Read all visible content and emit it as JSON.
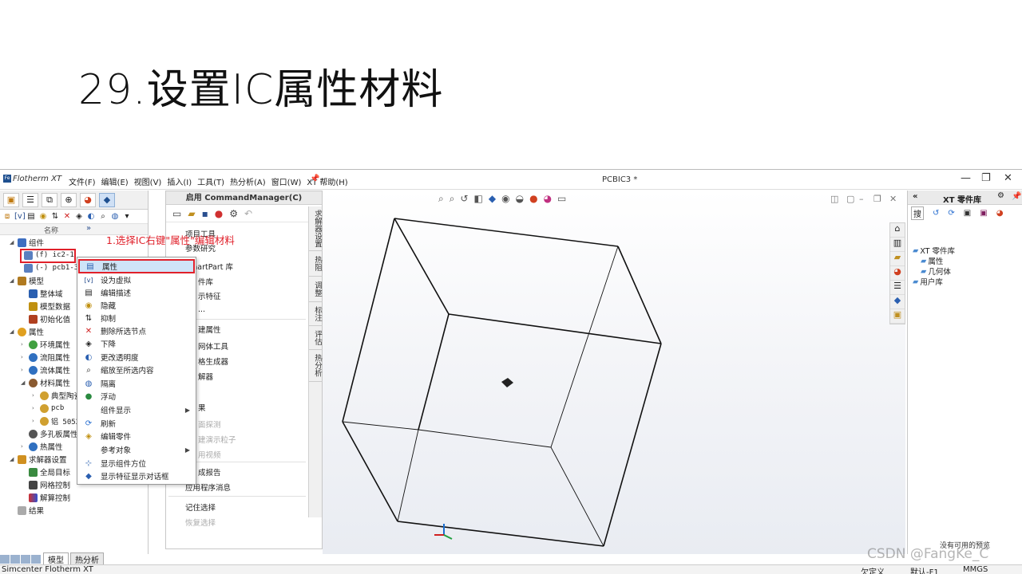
{
  "slide": {
    "title": "29.设置IC属性材料"
  },
  "titlebar": {
    "app_name": "Flotherm XT",
    "menu": [
      "文件(F)",
      "编辑(E)",
      "视图(V)",
      "插入(I)",
      "工具(T)",
      "热分析(A)",
      "窗口(W)",
      "XT 帮助(H)"
    ],
    "doc_title": "PCBIC3 *"
  },
  "left_panel": {
    "column_name": "名称",
    "annotation": "1.选择IC右键\"属性\"编辑材料",
    "tree": {
      "components": "组件",
      "ic": "(f) ic2-1",
      "pcb": "(-) pcb1-3",
      "model": "模型",
      "overall_domain": "整体域",
      "model_data": "模型数据",
      "initialization": "初始化值",
      "attributes": "属性",
      "env_attr": "环境属性",
      "flow_attr": "流阻属性",
      "fluid_attr": "流体属性",
      "material_attr": "材料属性",
      "typical": "典型陶瓷",
      "pcb_mat": "pcb",
      "al": "铝 5052",
      "porous": "多孔板属性",
      "thermal": "热属性",
      "solver": "求解器设置",
      "global_goal": "全局目标",
      "mesh": "网格控制",
      "solve_ctrl": "解算控制",
      "results": "结果"
    },
    "bottom_tabs": [
      "模型",
      "热分析"
    ]
  },
  "context_menu": {
    "items": [
      {
        "label": "属性",
        "icon": "properties-icon"
      },
      {
        "label": "设为虚拟",
        "icon": "virtual-icon"
      },
      {
        "label": "编辑描述",
        "icon": "description-icon"
      },
      {
        "label": "隐藏",
        "icon": "hide-icon"
      },
      {
        "label": "抑制",
        "icon": "suppress-icon"
      },
      {
        "label": "删除所选节点",
        "icon": "delete-icon"
      },
      {
        "label": "下降",
        "icon": "down-icon"
      },
      {
        "label": "更改透明度",
        "icon": "transparency-icon"
      },
      {
        "label": "缩放至所选内容",
        "icon": "zoom-icon"
      },
      {
        "label": "隔离",
        "icon": "isolate-icon"
      },
      {
        "label": "浮动",
        "icon": "float-icon"
      },
      {
        "label": "组件显示",
        "icon": "",
        "submenu": true
      },
      {
        "label": "刷新",
        "icon": "refresh-icon"
      },
      {
        "label": "编辑零件",
        "icon": "edit-part-icon"
      },
      {
        "label": "参考对象",
        "icon": "",
        "submenu": true
      },
      {
        "label": "显示组件方位",
        "icon": "axes-icon"
      },
      {
        "label": "显示特征显示对话框",
        "icon": "feature-icon"
      }
    ]
  },
  "command_manager": {
    "title": "启用 CommandManager(C)",
    "items": [
      {
        "label": "项目工具",
        "dim": false
      },
      {
        "label": "参数研究",
        "dim": false
      },
      {
        "label": "SmartPart 库",
        "dim": false
      },
      {
        "label": "件库",
        "dim": false
      },
      {
        "label": "示特征",
        "dim": false
      },
      {
        "label": "...",
        "dim": false
      },
      {
        "label": "建属性",
        "dim": false
      },
      {
        "label": "网体工具",
        "dim": false
      },
      {
        "label": "格生成器",
        "dim": false
      },
      {
        "label": "解器",
        "dim": false
      },
      {
        "label": "果",
        "dim": false
      },
      {
        "label": "面探测",
        "dim": true
      },
      {
        "label": "建演示粒子",
        "dim": true
      },
      {
        "label": "用视频",
        "dim": true
      },
      {
        "label": "成报告",
        "dim": false
      },
      {
        "label": "应用程序消息",
        "dim": false
      },
      {
        "label": "记住选择",
        "dim": false
      },
      {
        "label": "恢复选择",
        "dim": true
      }
    ],
    "vertical_tabs": [
      "求解器设置",
      "热阻",
      "调整",
      "标注",
      "评估",
      "热分析"
    ]
  },
  "right_panel": {
    "title": "XT 零件库",
    "search_label": "搜",
    "tree": [
      "XT 零件库",
      "属性",
      "几何体",
      "用户库"
    ],
    "preview_text": "没有可用的预览"
  },
  "statusbar": {
    "left": "Simcenter Flotherm XT",
    "underdefined": "欠定义",
    "default": "默认-F1",
    "units": "MMGS"
  },
  "watermark": "CSDN @FangKe_C",
  "colors": {
    "annotation": "#e0202a",
    "highlight": "#cfe4f8",
    "brand": "#1e4f8f"
  }
}
